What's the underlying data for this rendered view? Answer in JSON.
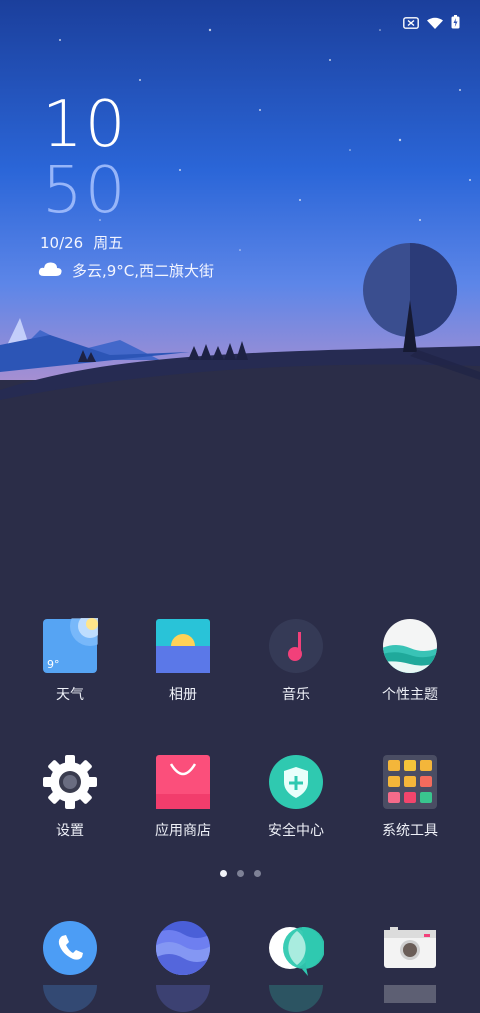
{
  "status_bar": {
    "icons": [
      "no-sim-icon",
      "wifi-icon",
      "battery-charging-icon"
    ]
  },
  "clock": {
    "hour": "10",
    "minute": "50"
  },
  "date": {
    "day": "10/26",
    "weekday": "周五"
  },
  "weather": {
    "icon": "cloud-icon",
    "text": "多云,9°C,西二旗大街"
  },
  "apps": [
    {
      "label": "天气",
      "icon": "weather-app-icon",
      "badge": "9°"
    },
    {
      "label": "相册",
      "icon": "gallery-app-icon"
    },
    {
      "label": "音乐",
      "icon": "music-app-icon"
    },
    {
      "label": "个性主题",
      "icon": "themes-app-icon"
    },
    {
      "label": "设置",
      "icon": "settings-app-icon"
    },
    {
      "label": "应用商店",
      "icon": "app-store-icon"
    },
    {
      "label": "安全中心",
      "icon": "security-center-icon"
    },
    {
      "label": "系统工具",
      "icon": "system-tools-folder-icon"
    }
  ],
  "page_indicator": {
    "pages": 3,
    "active_index": 0
  },
  "dock": [
    {
      "icon": "phone-app-icon"
    },
    {
      "icon": "browser-app-icon"
    },
    {
      "icon": "messages-app-icon"
    },
    {
      "icon": "camera-app-icon"
    }
  ],
  "colors": {
    "sky_top": "#1b3f9c",
    "sky_mid": "#2f6fe0",
    "horizon": "#9a8fd6",
    "ground": "#2b2d48",
    "accent_pink": "#f2407a",
    "accent_teal": "#2fc9b0",
    "accent_blue": "#4c9df5"
  }
}
